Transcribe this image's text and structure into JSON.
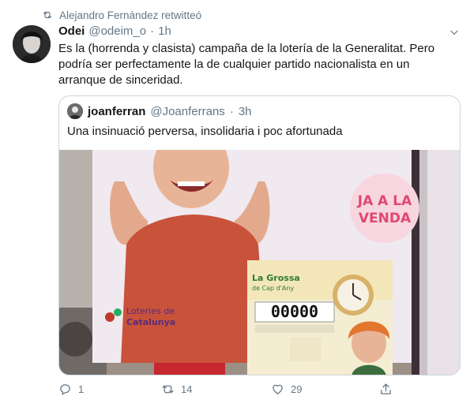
{
  "retweet": {
    "text": "Alejandro Fernández retwitteó",
    "icon": "retweet-icon"
  },
  "tweet": {
    "name": "Odei",
    "handle": "@odeim_o",
    "separator": "·",
    "time": "1h",
    "text": "Es la (horrenda y clasista) campaña de la lotería de la Generalitat. Pero podría ser perfectamente la de cualquier partido nacionalista en un arranque de sinceridad."
  },
  "quote": {
    "name": "joanferran",
    "handle": "@Joanferrans",
    "separator": "·",
    "time": "3h",
    "text": "Una insinuació perversa, insolidaria i poc afortunada",
    "image": {
      "sign_text": "JA A LA VENDA",
      "brand": "Loteries de Catalunya",
      "ticket_title": "La Grossa de Cap d'Any",
      "ticket_number": "00000"
    }
  },
  "actions": {
    "reply_count": "1",
    "retweet_count": "14",
    "like_count": "29"
  },
  "colors": {
    "secondary_text": "#657786",
    "border": "#ccd6dd",
    "link": "#1da1f2"
  }
}
